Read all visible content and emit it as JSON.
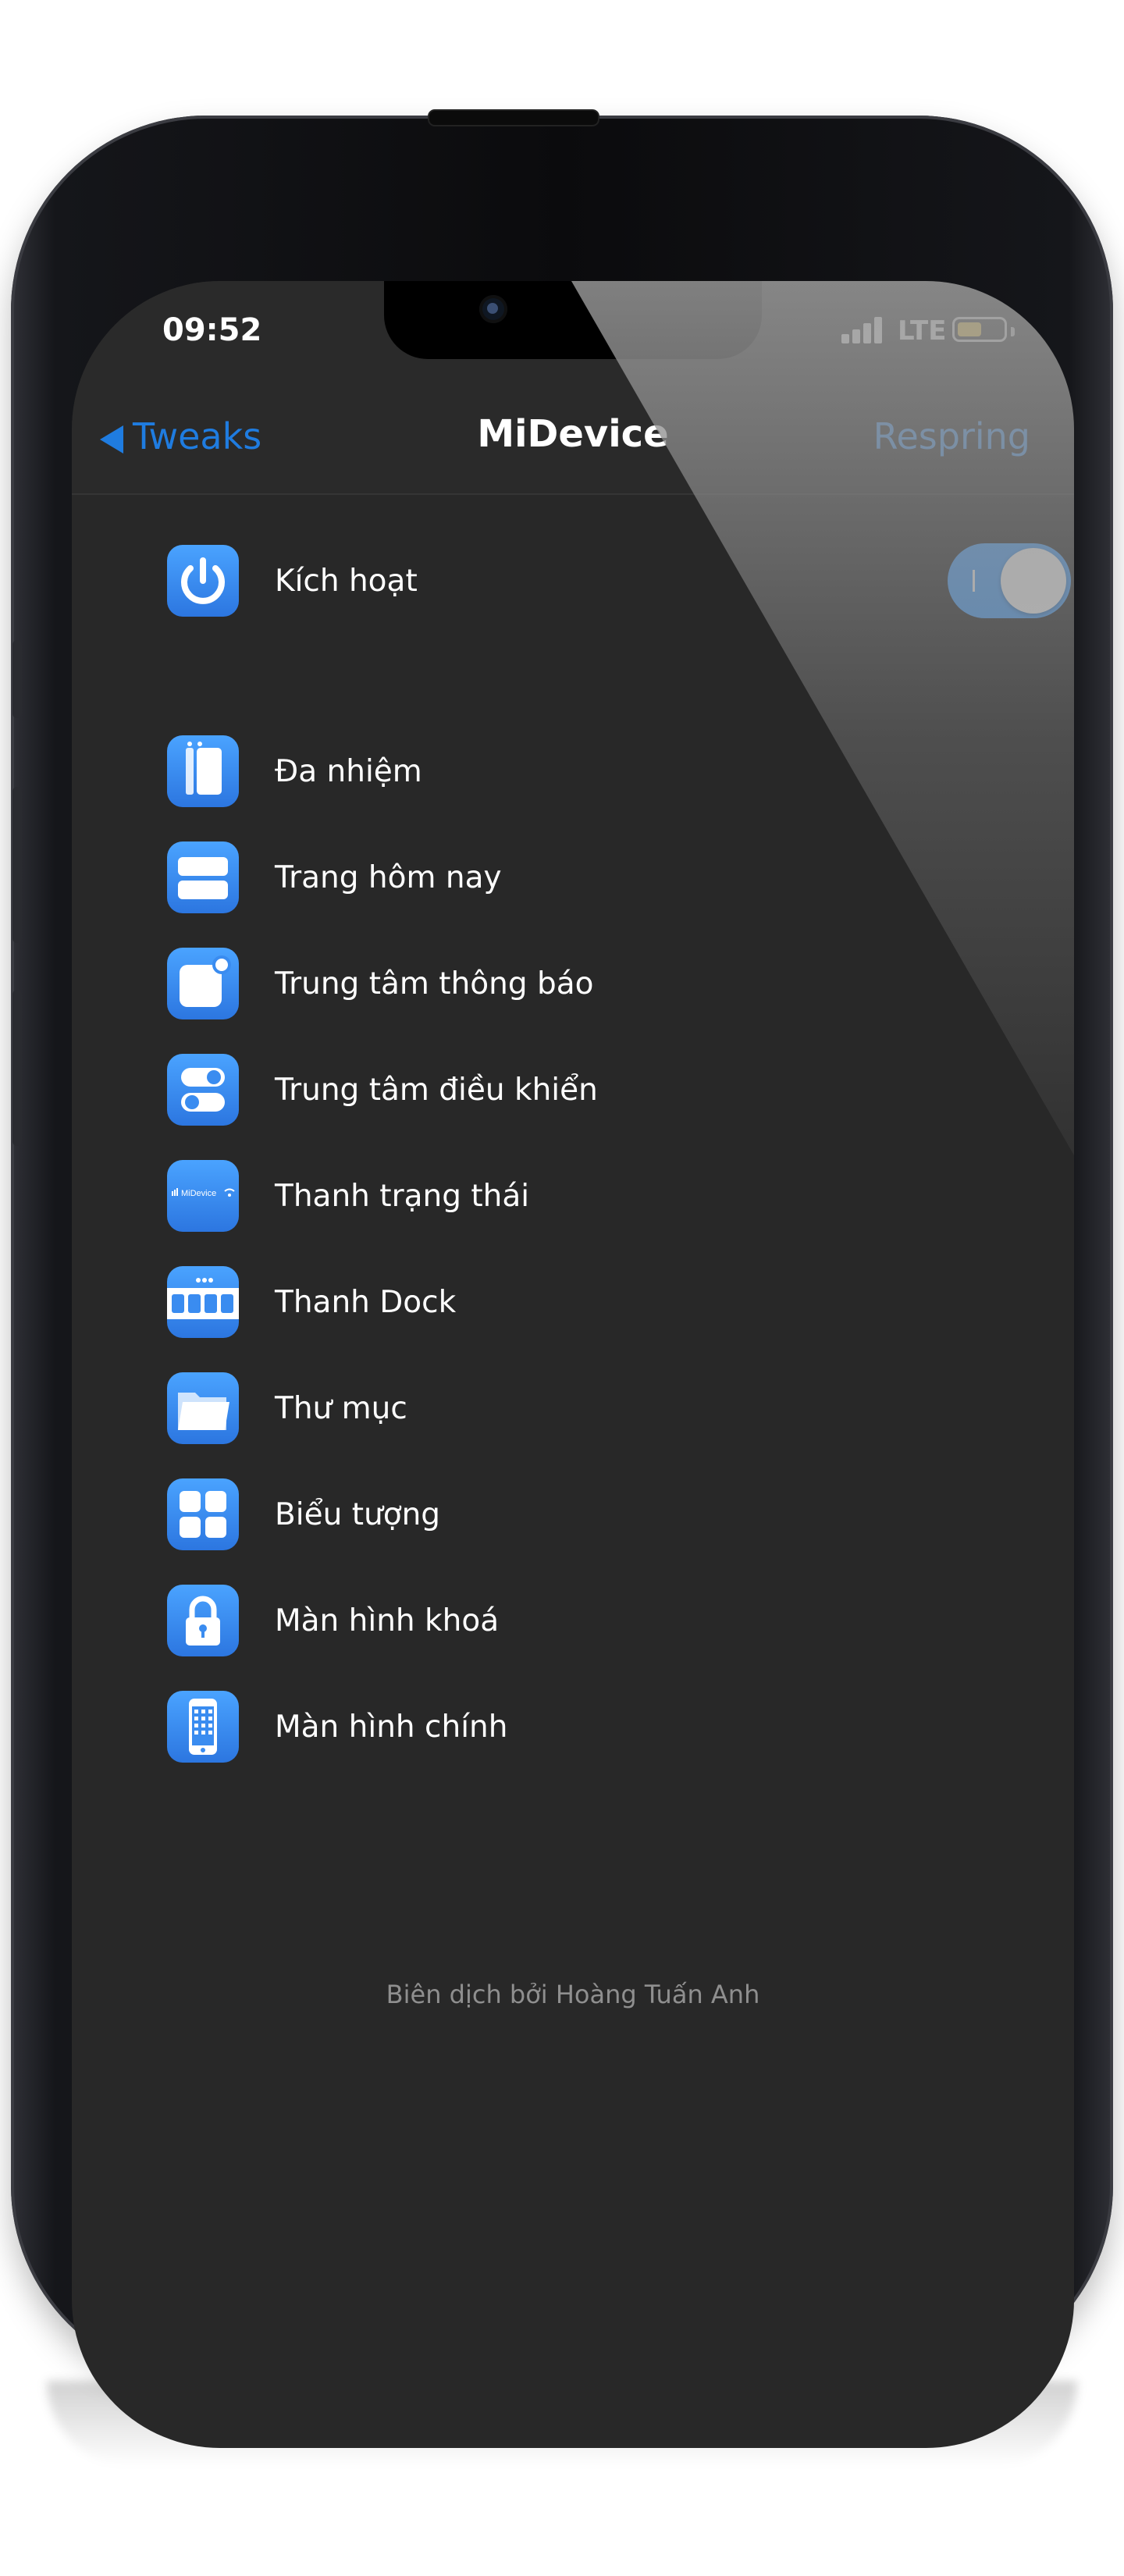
{
  "status_bar": {
    "time": "09:52",
    "network": "LTE",
    "battery_color": "#ffd54a"
  },
  "nav": {
    "back_label": "Tweaks",
    "title": "MiDevice",
    "action_label": "Respring",
    "accent": "#1f7ce0"
  },
  "enable_row": {
    "label": "Kích hoạt",
    "icon": "power-icon",
    "enabled": true
  },
  "items": [
    {
      "label": "Đa nhiệm",
      "icon": "multitasking-icon"
    },
    {
      "label": "Trang hôm nay",
      "icon": "today-view-icon"
    },
    {
      "label": "Trung tâm thông báo",
      "icon": "notification-center-icon"
    },
    {
      "label": "Trung tâm điều khiển",
      "icon": "control-center-icon"
    },
    {
      "label": "Thanh trạng thái",
      "icon": "status-bar-icon",
      "icon_text": "MiDevice"
    },
    {
      "label": "Thanh Dock",
      "icon": "dock-icon"
    },
    {
      "label": "Thư mục",
      "icon": "folder-icon"
    },
    {
      "label": "Biểu tượng",
      "icon": "app-icons-icon"
    },
    {
      "label": "Màn hình khoá",
      "icon": "lock-icon"
    },
    {
      "label": "Màn hình chính",
      "icon": "home-screen-icon"
    }
  ],
  "footer": {
    "credit": "Biên dịch bởi Hoàng Tuấn Anh"
  }
}
